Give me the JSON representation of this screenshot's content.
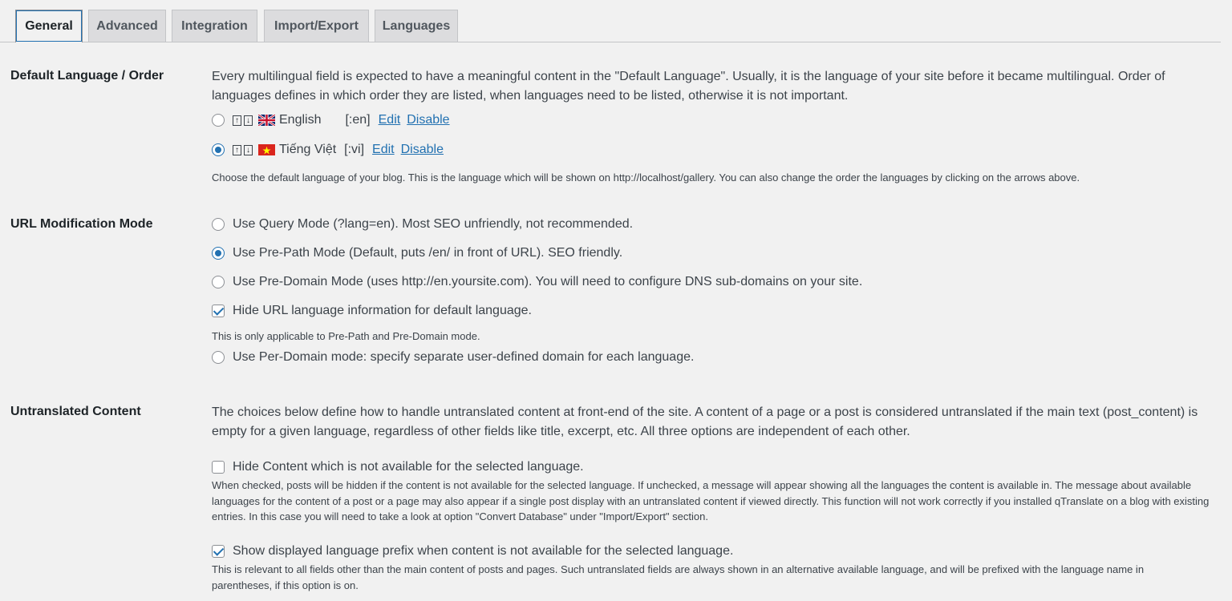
{
  "tabs": [
    {
      "label": "General",
      "active": true
    },
    {
      "label": "Advanced"
    },
    {
      "label": "Integration"
    },
    {
      "label": "Import/Export"
    },
    {
      "label": "Languages"
    }
  ],
  "default_language": {
    "title": "Default Language / Order",
    "description": "Every multilingual field is expected to have a meaningful content in the \"Default Language\". Usually, it is the language of your site before it became multilingual. Order of languages defines in which order they are listed, when languages need to be listed, otherwise it is not important.",
    "languages": [
      {
        "name": "English",
        "code": "[:en]",
        "edit": "Edit",
        "disable": "Disable",
        "selected": false,
        "flag": "uk-flag-icon"
      },
      {
        "name": "Tiếng Việt",
        "code": "[:vi]",
        "edit": "Edit",
        "disable": "Disable",
        "selected": true,
        "flag": "vn-flag-icon"
      }
    ],
    "note": "Choose the default language of your blog. This is the language which will be shown on http://localhost/gallery. You can also change the order the languages by clicking on the arrows above."
  },
  "url_mode": {
    "title": "URL Modification Mode",
    "options": [
      "Use Query Mode (?lang=en). Most SEO unfriendly, not recommended.",
      "Use Pre-Path Mode (Default, puts /en/ in front of URL). SEO friendly.",
      "Use Pre-Domain Mode (uses http://en.yoursite.com). You will need to configure DNS sub-domains on your site."
    ],
    "selected_index": 1,
    "hide_url_label": "Hide URL language information for default language.",
    "hide_url_checked": true,
    "hide_url_note": "This is only applicable to Pre-Path and Pre-Domain mode.",
    "per_domain_label": "Use Per-Domain mode: specify separate user-defined domain for each language."
  },
  "untranslated": {
    "title": "Untranslated Content",
    "description": "The choices below define how to handle untranslated content at front-end of the site. A content of a page or a post is considered untranslated if the main text (post_content) is empty for a given language, regardless of other fields like title, excerpt, etc. All three options are independent of each other.",
    "hide_content_label": "Hide Content which is not available for the selected language.",
    "hide_content_checked": false,
    "hide_content_note": "When checked, posts will be hidden if the content is not available for the selected language. If unchecked, a message will appear showing all the languages the content is available in. The message about available languages for the content of a post or a page may also appear if a single post display with an untranslated content if viewed directly. This function will not work correctly if you installed qTranslate on a blog with existing entries. In this case you will need to take a look at option \"Convert Database\" under \"Import/Export\" section.",
    "show_prefix_label": "Show displayed language prefix when content is not available for the selected language.",
    "show_prefix_checked": true,
    "show_prefix_note": "This is relevant to all fields other than the main content of posts and pages. Such untranslated fields are always shown in an alternative available language, and will be prefixed with the language name in parentheses, if this option is on."
  },
  "arrows": {
    "up": "↑",
    "down": "↓"
  }
}
